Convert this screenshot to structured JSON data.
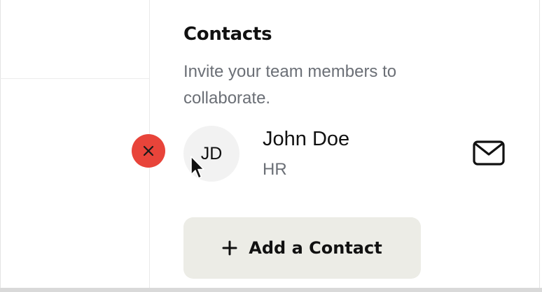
{
  "panel": {
    "title": "Contacts",
    "subtitle": "Invite your team members to collaborate."
  },
  "contacts": [
    {
      "initials": "JD",
      "name": "John Doe",
      "role": "HR",
      "remove_icon": "close-icon",
      "mail_icon": "mail-icon"
    }
  ],
  "actions": {
    "add_contact_label": "Add a Contact",
    "add_icon": "plus-icon"
  },
  "colors": {
    "remove_button": "#e8443a",
    "add_button_bg": "#ececE6",
    "title_text": "#111111",
    "muted_text": "#6b6f76",
    "avatar_bg": "#f2f2f2"
  }
}
